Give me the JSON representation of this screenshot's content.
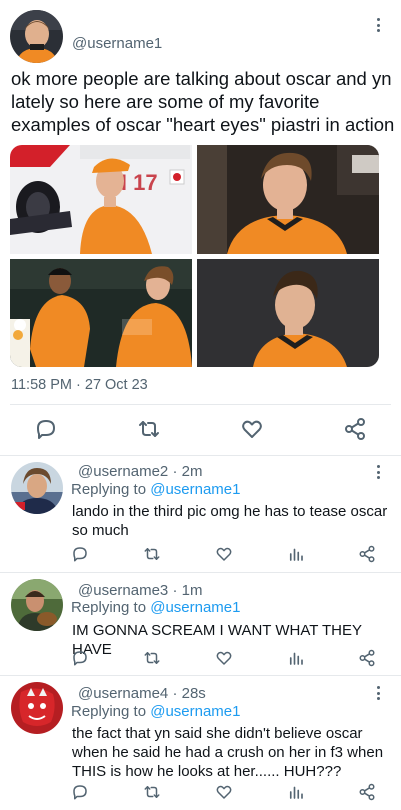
{
  "main_tweet": {
    "username": "@username1",
    "text": "ok more people are talking about oscar and yn lately so here are some of my favorite examples of oscar \"heart eyes\" piastri in action",
    "timestamp": "11:58 PM · 27 Oct 23",
    "photo_text": "CI 17"
  },
  "replies": [
    {
      "header": "@username2 · 2m",
      "replying_prefix": "Replying to ",
      "replying_to": "@username1",
      "text": "lando in the third pic omg he has to tease oscar so much"
    },
    {
      "header": "@username3 · 1m",
      "replying_prefix": "Replying to ",
      "replying_to": "@username1",
      "text": "IM GONNA SCREAM I WANT WHAT THEY HAVE"
    },
    {
      "header": "@username4 · 28s",
      "replying_prefix": "Replying to ",
      "replying_to": "@username1",
      "text": "the fact that yn said she didn't believe oscar when he said he had a crush on her in f3 when THIS is how he looks at her...... HUH???"
    }
  ],
  "icons": {
    "reply": "comment-icon",
    "retweet": "retweet-icon",
    "like": "heart-icon",
    "stats": "stats-icon",
    "share": "share-icon",
    "more": "more-vertical-icon"
  },
  "colors": {
    "text": "#0f1419",
    "secondary": "#536471",
    "link": "#1d9bf0",
    "divider": "#e6e9ec"
  }
}
